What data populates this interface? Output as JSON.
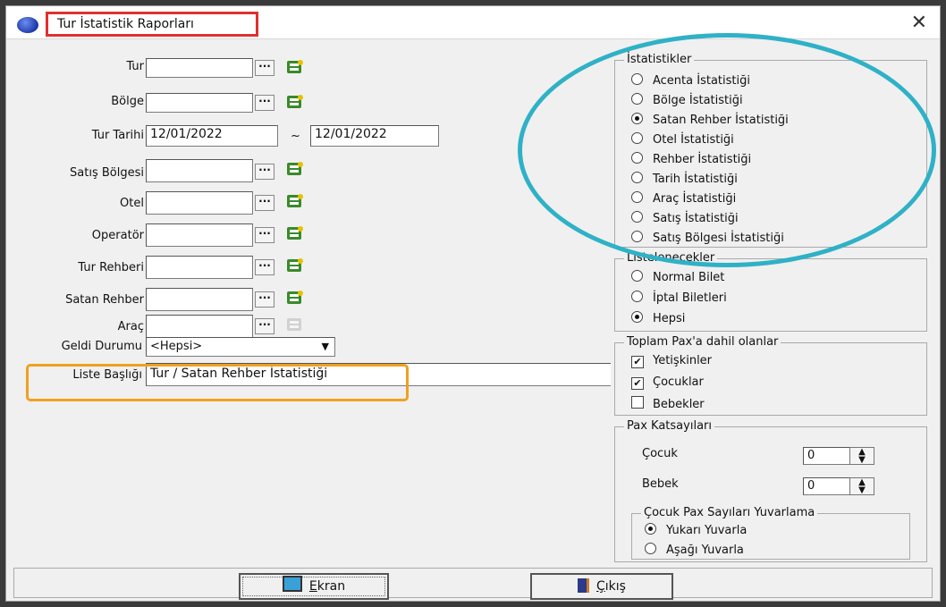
{
  "window": {
    "title": "Tur İstatistik Raporları",
    "close_glyph": "✕"
  },
  "form": {
    "tur_label": "Tur",
    "bolge_label": "Bölge",
    "tur_tarihi_label": "Tur Tarihi",
    "date_start": "12/01/2022",
    "date_sep": "~",
    "date_end": "12/01/2022",
    "satis_bolgesi_label": "Satış Bölgesi",
    "otel_label": "Otel",
    "operator_label": "Operatör",
    "tur_rehberi_label": "Tur Rehberi",
    "satan_rehber_label": "Satan Rehber",
    "arac_label": "Araç",
    "geldi_durumu_label": "Geldi Durumu",
    "geldi_durumu_value": "<Hepsi>",
    "liste_basligi_label": "Liste Başlığı",
    "liste_basligi_value": "Tur / Satan Rehber İstatistiği",
    "dots_glyph": "···"
  },
  "istatistikler": {
    "title": "İstatistikler",
    "options": [
      "Acenta İstatistiği",
      "Bölge İstatistiği",
      "Satan Rehber İstatistiği",
      "Otel İstatistiği",
      "Rehber İstatistiği",
      "Tarih İstatistiği",
      "Araç İstatistiği",
      "Satış İstatistiği",
      "Satış Bölgesi İstatistiği"
    ]
  },
  "listelenecekler": {
    "title": "Listelenecekler",
    "options": [
      "Normal Bilet",
      "İptal Biletleri",
      "Hepsi"
    ]
  },
  "toplam_pax": {
    "title": "Toplam Pax'a dahil olanlar",
    "options": [
      "Yetişkinler",
      "Çocuklar",
      "Bebekler"
    ],
    "check_glyph": "✔"
  },
  "pax_katsayilari": {
    "title": "Pax Katsayıları",
    "cocuk_label": "Çocuk",
    "cocuk_value": "0",
    "bebek_label": "Bebek",
    "bebek_value": "0",
    "spin_up": "▲",
    "spin_down": "▼"
  },
  "yuvarlama": {
    "title": "Çocuk Pax Sayıları Yuvarlama",
    "options": [
      "Yukarı Yuvarla",
      "Aşağı Yuvarla"
    ]
  },
  "buttons": {
    "ekran_first": "E",
    "ekran_rest": "kran",
    "cikis_first": "Ç",
    "cikis_rest": "ıkış"
  },
  "colors": {
    "title_highlight": "#e03030",
    "oval_annotation": "#2fb1c6",
    "liste_highlight": "#f0a020",
    "picker_icon": "#3a8a2a"
  }
}
